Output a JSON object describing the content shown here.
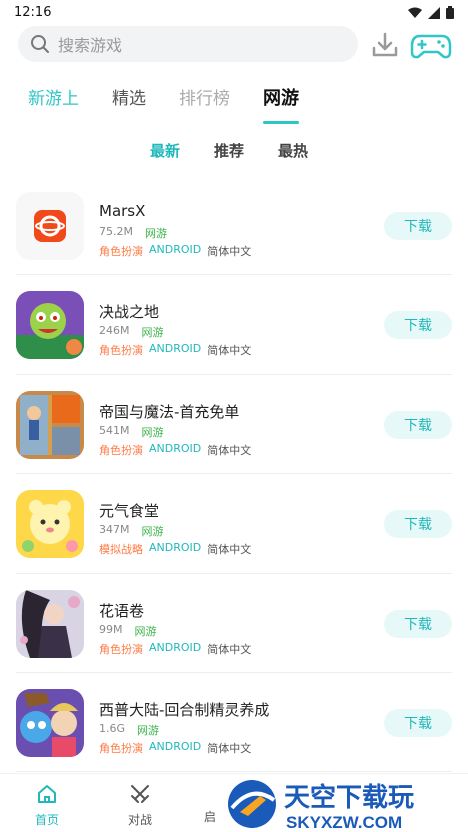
{
  "status": {
    "time": "12:16"
  },
  "search": {
    "placeholder": "搜索游戏"
  },
  "main_tabs": [
    {
      "label": "新游上"
    },
    {
      "label": "精选"
    },
    {
      "label": "排行榜"
    },
    {
      "label": "网游"
    }
  ],
  "sub_tabs": [
    {
      "label": "最新"
    },
    {
      "label": "推荐"
    },
    {
      "label": "最热"
    }
  ],
  "games": [
    {
      "name": "MarsX",
      "size": "75.2M",
      "type": "网游",
      "genre": "角色扮演",
      "platform": "ANDROID",
      "lang": "简体中文",
      "action": "下载"
    },
    {
      "name": "决战之地",
      "size": "246M",
      "type": "网游",
      "genre": "角色扮演",
      "platform": "ANDROID",
      "lang": "简体中文",
      "action": "下载"
    },
    {
      "name": "帝国与魔法-首充免单",
      "size": "541M",
      "type": "网游",
      "genre": "角色扮演",
      "platform": "ANDROID",
      "lang": "简体中文",
      "action": "下载"
    },
    {
      "name": "元气食堂",
      "size": "347M",
      "type": "网游",
      "genre": "模拟战略",
      "platform": "ANDROID",
      "lang": "简体中文",
      "action": "下载"
    },
    {
      "name": "花语卷",
      "size": "99M",
      "type": "网游",
      "genre": "角色扮演",
      "platform": "ANDROID",
      "lang": "简体中文",
      "action": "下载"
    },
    {
      "name": "西普大陆-回合制精灵养成",
      "size": "1.6G",
      "type": "网游",
      "genre": "角色扮演",
      "platform": "ANDROID",
      "lang": "简体中文",
      "action": "下载"
    }
  ],
  "bottom_nav": [
    {
      "label": "首页"
    },
    {
      "label": "对战"
    },
    {
      "label": "启"
    }
  ],
  "watermark": {
    "title": "天空下载玩",
    "url": "SKYXZW.COM"
  },
  "colors": {
    "accent": "#22b8bb",
    "genre": "#ff7a45",
    "type": "#39b54a"
  }
}
